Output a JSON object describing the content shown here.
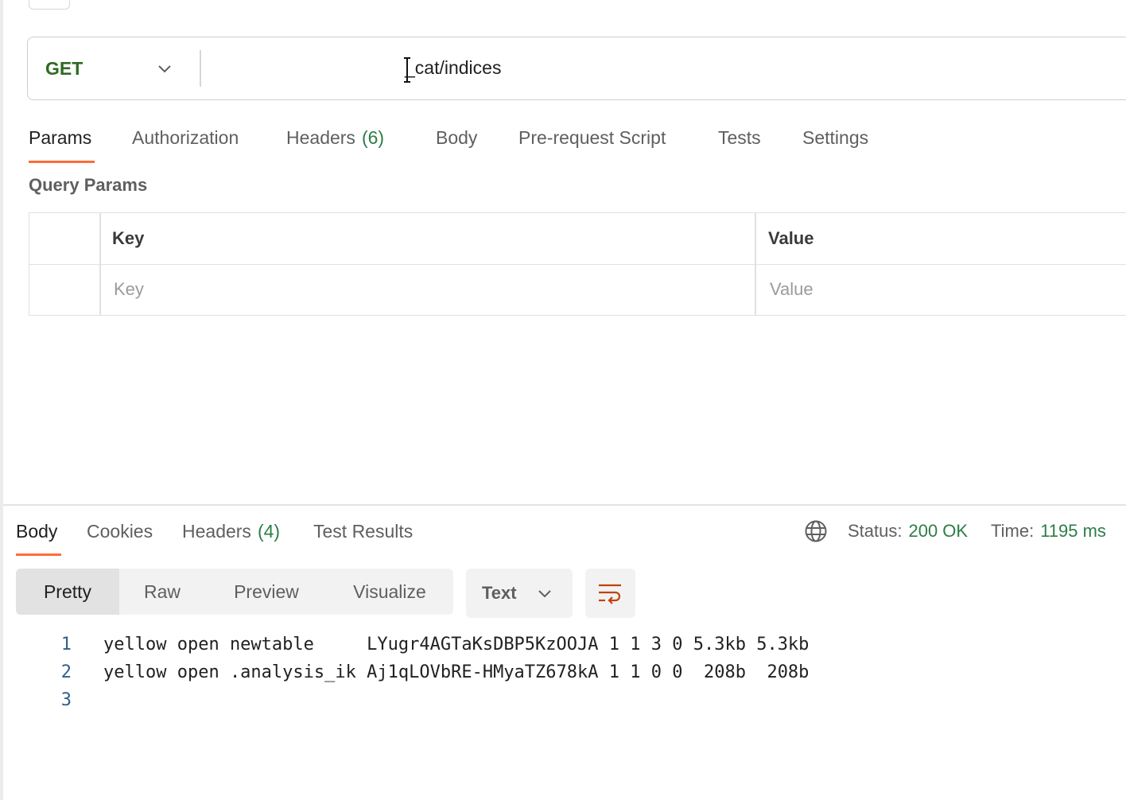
{
  "request": {
    "method": "GET",
    "url": "_cat/indices"
  },
  "request_tabs": [
    {
      "label": "Params",
      "count": ""
    },
    {
      "label": "Authorization",
      "count": ""
    },
    {
      "label": "Headers",
      "count": "(6)"
    },
    {
      "label": "Body",
      "count": ""
    },
    {
      "label": "Pre-request Script",
      "count": ""
    },
    {
      "label": "Tests",
      "count": ""
    },
    {
      "label": "Settings",
      "count": ""
    }
  ],
  "query_params": {
    "title": "Query Params",
    "headers": {
      "key": "Key",
      "value": "Value"
    },
    "placeholders": {
      "key": "Key",
      "value": "Value"
    }
  },
  "response_tabs": [
    {
      "label": "Body",
      "count": ""
    },
    {
      "label": "Cookies",
      "count": ""
    },
    {
      "label": "Headers",
      "count": "(4)"
    },
    {
      "label": "Test Results",
      "count": ""
    }
  ],
  "response_meta": {
    "status_label": "Status:",
    "status_value": "200 OK",
    "time_label": "Time:",
    "time_value": "1195 ms"
  },
  "view_modes": [
    "Pretty",
    "Raw",
    "Preview",
    "Visualize"
  ],
  "format": "Text",
  "code_lines": [
    {
      "num": "1",
      "text": "yellow open newtable     LYugr4AGTaKsDBP5KzOOJA 1 1 3 0 5.3kb 5.3kb"
    },
    {
      "num": "2",
      "text": "yellow open .analysis_ik Aj1qLOVbRE-HMyaTZ678kA 1 1 0 0  208b  208b"
    },
    {
      "num": "3",
      "text": ""
    }
  ],
  "icons": {
    "method_dropdown": "chevron-down-icon",
    "network": "globe-icon",
    "format_dropdown": "chevron-down-icon",
    "wrap": "wrap-lines-icon",
    "cursor": "text-cursor-icon"
  },
  "colors": {
    "accent": "#ff6c37",
    "method_get": "#2d6b1f",
    "success": "#2d7d46",
    "line_number": "#2f5f8f"
  }
}
